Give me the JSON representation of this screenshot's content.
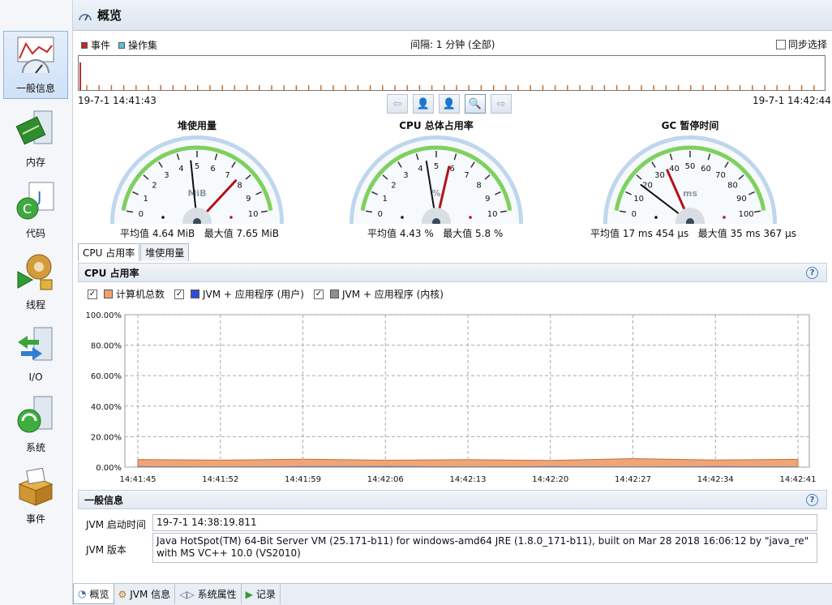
{
  "header": {
    "title": "概览",
    "icon": "overview-icon"
  },
  "left_nav": [
    {
      "label": "一般信息",
      "icon": "general-info-icon",
      "selected": true
    },
    {
      "label": "内存",
      "icon": "memory-icon"
    },
    {
      "label": "代码",
      "icon": "code-icon"
    },
    {
      "label": "线程",
      "icon": "threads-icon"
    },
    {
      "label": "I/O",
      "icon": "io-icon"
    },
    {
      "label": "系统",
      "icon": "system-icon"
    },
    {
      "label": "事件",
      "icon": "events-icon"
    }
  ],
  "events": {
    "legend_events": "事件",
    "legend_ops": "操作集",
    "interval": "间隔: 1 分钟 (全部)",
    "sync_label": "同步选择",
    "start_time": "19-7-1 14:41:43",
    "end_time": "19-7-1 14:42:44",
    "colors": {
      "events": "#c62828",
      "ops": "#5ec0e0"
    }
  },
  "nav_buttons": [
    "back-arrow-icon",
    "zoom-out-user-icon",
    "zoom-user-icon",
    "zoom-in-icon",
    "forward-arrow-icon"
  ],
  "gauges": [
    {
      "title": "堆使用量",
      "unit": "MiB",
      "ticks": [
        "0",
        "1",
        "2",
        "3",
        "4",
        "5",
        "6",
        "7",
        "8",
        "9",
        "10"
      ],
      "avg_value": 4.64,
      "max_value": 7.65,
      "scale_max": 10,
      "stats_avg": "平均值 4.64 MiB",
      "stats_max": "最大值 7.65 MiB"
    },
    {
      "title": "CPU 总体占用率",
      "unit": "%",
      "ticks": [
        "0",
        "1",
        "2",
        "3",
        "4",
        "5",
        "6",
        "7",
        "8",
        "9",
        "10"
      ],
      "avg_value": 4.43,
      "max_value": 5.8,
      "scale_max": 10,
      "stats_avg": "平均值 4.43 %",
      "stats_max": "最大值 5.8 %"
    },
    {
      "title": "GC 暂停时间",
      "unit": "ms",
      "ticks": [
        "0",
        "10",
        "20",
        "30",
        "40",
        "50",
        "60",
        "70",
        "80",
        "90",
        "100"
      ],
      "avg_value": 17.454,
      "max_value": 35.367,
      "scale_max": 100,
      "stats_avg": "平均值 17 ms 454 μs",
      "stats_max": "最大值 35 ms 367 μs"
    }
  ],
  "chart_tabs": [
    "CPU 占用率",
    "堆使用量"
  ],
  "cpu_panel": {
    "title": "CPU 占用率",
    "legend": [
      {
        "label": "计算机总数",
        "color": "#f0a070",
        "checked": true
      },
      {
        "label": "JVM + 应用程序 (用户)",
        "color": "#2f4fd6",
        "checked": true
      },
      {
        "label": "JVM + 应用程序 (内核)",
        "color": "#8f8f8f",
        "checked": true
      }
    ]
  },
  "chart_data": {
    "type": "area",
    "x": [
      "14:41:45",
      "14:41:52",
      "14:41:59",
      "14:42:06",
      "14:42:13",
      "14:42:20",
      "14:42:27",
      "14:42:34",
      "14:42:41"
    ],
    "yticks": [
      "100.00%",
      "80.00%",
      "60.00%",
      "40.00%",
      "20.00%",
      "0.00%"
    ],
    "ylim": [
      0,
      100
    ],
    "series": [
      {
        "name": "计算机总数",
        "values": [
          5,
          4.6,
          5.2,
          4.5,
          4.9,
          4.4,
          5.6,
          4.7,
          5.1
        ]
      },
      {
        "name": "JVM + 应用程序 (用户)",
        "values": [
          0.3,
          0.2,
          0.3,
          0.4,
          0.2,
          0.3,
          0.2,
          0.3,
          0.2
        ]
      },
      {
        "name": "JVM + 应用程序 (内核)",
        "values": [
          0.1,
          0.1,
          0.1,
          0.1,
          0.1,
          0.1,
          0.1,
          0.1,
          0.1
        ]
      }
    ],
    "grid": true
  },
  "info": {
    "title": "一般信息",
    "start_label": "JVM 启动时间",
    "start_value": "19-7-1 14:38:19.811",
    "version_label": "JVM 版本",
    "version_value": "Java HotSpot(TM) 64-Bit Server VM (25.171-b11) for windows-amd64 JRE (1.8.0_171-b11), built on Mar 28 2018 16:06:12 by \"java_re\" with MS VC++ 10.0 (VS2010)"
  },
  "bottom_tabs": [
    {
      "label": "概览",
      "icon": "overview-icon",
      "active": true
    },
    {
      "label": "JVM 信息",
      "icon": "jvm-info-icon"
    },
    {
      "label": "系统属性",
      "icon": "properties-icon"
    },
    {
      "label": "记录",
      "icon": "record-icon"
    }
  ]
}
